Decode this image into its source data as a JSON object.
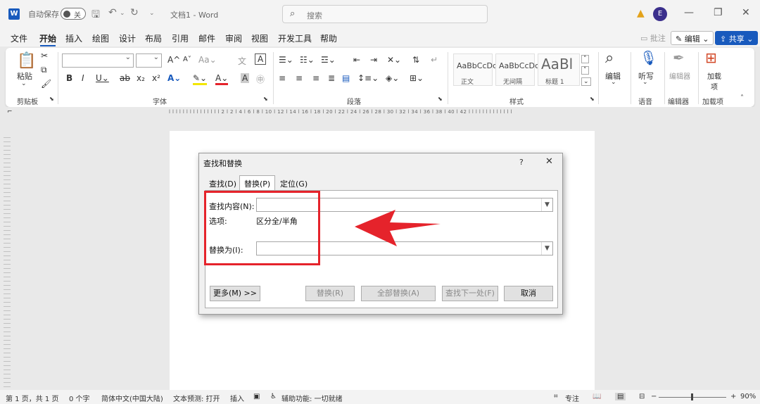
{
  "titlebar": {
    "autosave_label": "自动保存",
    "autosave_state": "关",
    "doc_title": "文档1 - Word",
    "search_placeholder": "搜索",
    "user_initial": "E"
  },
  "menu": {
    "items": [
      "文件",
      "开始",
      "插入",
      "绘图",
      "设计",
      "布局",
      "引用",
      "邮件",
      "审阅",
      "视图",
      "开发工具",
      "帮助"
    ],
    "active": "开始",
    "comment_label": "批注",
    "edit_label": "编辑",
    "share_label": "共享"
  },
  "ribbon": {
    "groups": [
      "剪贴板",
      "字体",
      "段落",
      "样式",
      "语音",
      "编辑器",
      "加载项"
    ],
    "paste_label": "粘贴",
    "styles": [
      {
        "sample": "AaBbCcDc",
        "name": "正文"
      },
      {
        "sample": "AaBbCcDc",
        "name": "无间隔"
      },
      {
        "sample": "AaBl",
        "name": "标题 1"
      }
    ],
    "editing_label": "编辑",
    "dictate_label": "听写",
    "editor_label": "编辑器",
    "addins_label": "加载项"
  },
  "ruler": {
    "marks": "l l l l l l l l l l l l l l l 2 l 2 l 4 l 6 l 8 l 10 l 12 l 14 l 16 l 18 l 20 l 22 l 24 l 26 l 28 l 30 l 32 l 34 l 36 l 38 l 40 l 42 l l l l l l l l l l l l l"
  },
  "dialog": {
    "title": "查找和替换",
    "help": "?",
    "close": "✕",
    "tabs": [
      "查找(D)",
      "替换(P)",
      "定位(G)"
    ],
    "selected_tab": "替换(P)",
    "find_label": "查找内容(N):",
    "find_value": "",
    "options_label": "选项:",
    "options_value": "区分全/半角",
    "replace_label": "替换为(I):",
    "replace_value": "",
    "buttons": {
      "more": "更多(M) >>",
      "replace": "替换(R)",
      "replace_all": "全部替换(A)",
      "find_next": "查找下一处(F)",
      "cancel": "取消"
    }
  },
  "statusbar": {
    "page": "第 1 页，共 1 页",
    "words": "0 个字",
    "language": "简体中文(中国大陆)",
    "text_prediction": "文本预测: 打开",
    "insert_mode": "插入",
    "accessibility": "辅助功能: 一切就绪",
    "focus": "专注",
    "zoom": "90%"
  },
  "colors": {
    "brand": "#185abd",
    "annotation_red": "#e5232b"
  }
}
